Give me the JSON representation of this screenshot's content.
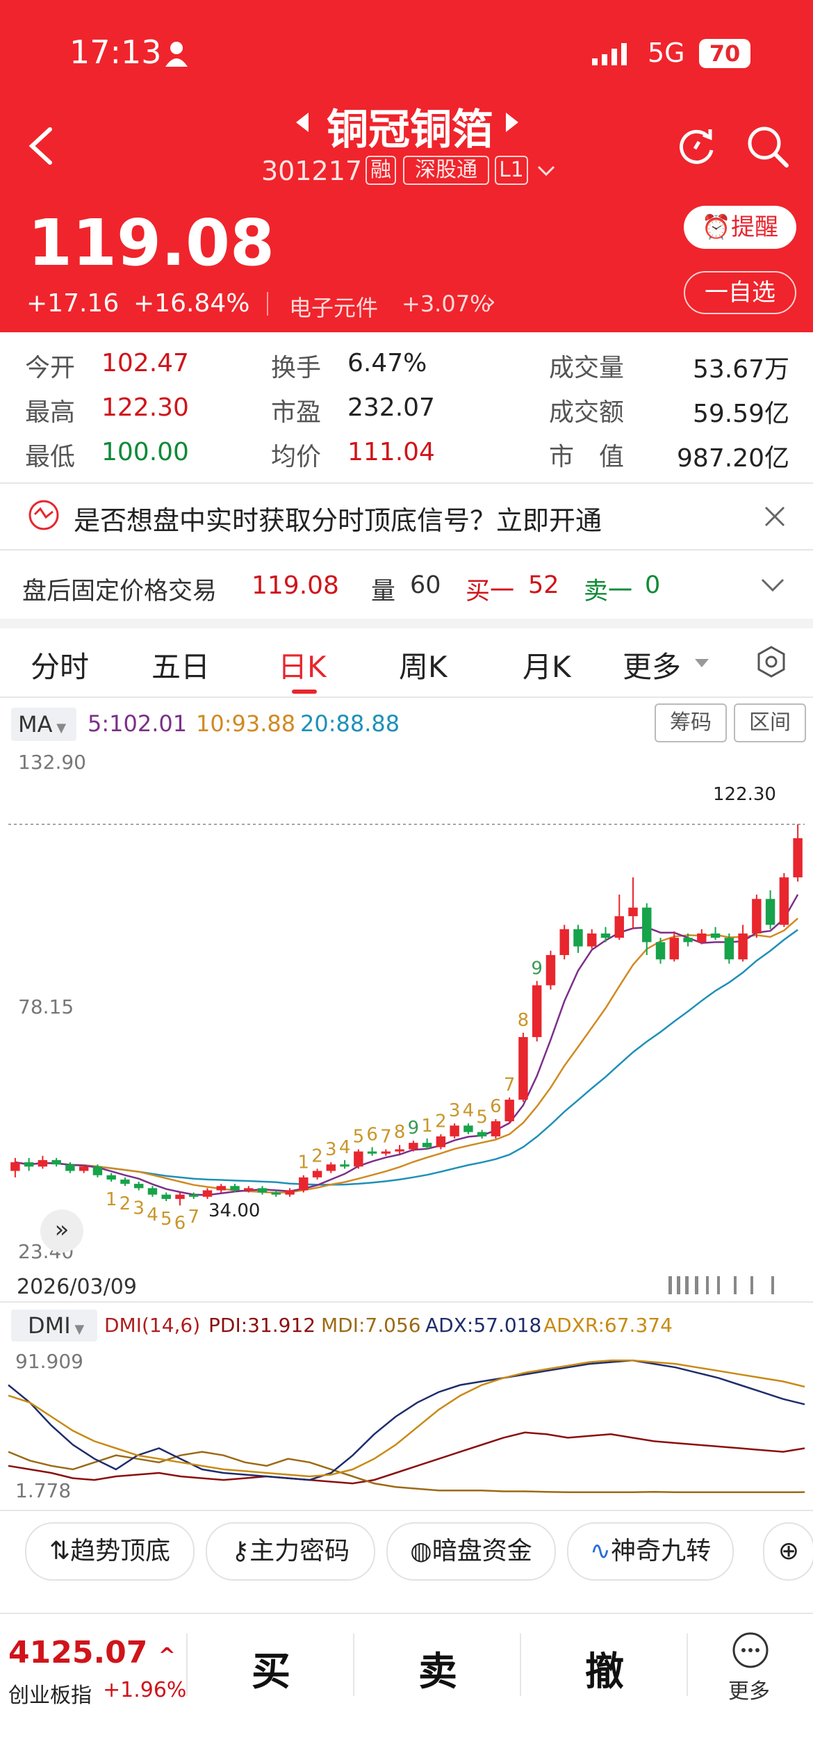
{
  "status_bar": {
    "time": "17:13",
    "network": "5G",
    "battery": "70"
  },
  "stock": {
    "name": "铜冠铜箔",
    "code": "301217",
    "tags": [
      "融",
      "深股通",
      "L1"
    ],
    "price": "119.08",
    "change": "+17.16",
    "change_pct": "+16.84%",
    "sector": "电子元件",
    "sector_change": "+3.07%",
    "remind_label": "提醒",
    "watchlist_label": "一自选"
  },
  "stats": {
    "open_label": "今开",
    "open": "102.47",
    "high_label": "最高",
    "high": "122.30",
    "low_label": "最低",
    "low": "100.00",
    "turnover_label": "换手",
    "turnover": "6.47%",
    "pe_label": "市盈",
    "pe": "232.07",
    "avg_label": "均价",
    "avg": "111.04",
    "volume_label": "成交量",
    "volume": "53.67万",
    "amount_label": "成交额",
    "amount": "59.59亿",
    "mktcap_label": "市　值",
    "mktcap": "987.20亿"
  },
  "signal_banner": "是否想盘中实时获取分时顶底信号？立即开通",
  "after_hours": {
    "label": "盘后固定价格交易",
    "price": "119.08",
    "volume_label": "量",
    "volume": "60",
    "bid_label": "买一",
    "bid": "52",
    "ask_label": "卖一",
    "ask": "0"
  },
  "tabs": [
    "分时",
    "五日",
    "日K",
    "周K",
    "月K",
    "更多"
  ],
  "active_tab": "日K",
  "ma": {
    "label": "MA",
    "ma5": "5:102.01",
    "ma10": "10:93.88",
    "ma20": "20:88.88"
  },
  "chart_buttons": {
    "chips": "筹码",
    "range": "区间"
  },
  "colors": {
    "up": "#e8262e",
    "down": "#16a34a",
    "ma5": "#7c2f8a",
    "ma10": "#d08a22",
    "ma20": "#1e90b8",
    "header": "#f0242c"
  },
  "chart_data": [
    {
      "type": "candlestick",
      "y_ticks": [
        "132.90",
        "78.15",
        "23.40"
      ],
      "ylim": [
        23.4,
        132.9
      ],
      "date_label": "2026/03/09",
      "high_marker": "122.30",
      "low_marker": "34.00",
      "td_numbers_up": [
        "1",
        "2",
        "3",
        "4",
        "5",
        "6",
        "7",
        "8",
        "9",
        "1",
        "2",
        "3",
        "4",
        "5",
        "6",
        "7",
        "8",
        "9"
      ],
      "td_numbers_down": [
        "1",
        "2",
        "3",
        "4",
        "5",
        "6",
        "7"
      ],
      "candles": [
        [
          42,
          44,
          40.5,
          45
        ],
        [
          44,
          43,
          42,
          45
        ],
        [
          43,
          44.5,
          42.5,
          45.5
        ],
        [
          44.5,
          43.5,
          43,
          45
        ],
        [
          43.5,
          42,
          41.5,
          44
        ],
        [
          42,
          43,
          41.5,
          43.5
        ],
        [
          43,
          41,
          40.5,
          43.5
        ],
        [
          41,
          40,
          39.5,
          41.5
        ],
        [
          40,
          39,
          38.5,
          40.5
        ],
        [
          39,
          38,
          37.5,
          39.5
        ],
        [
          38,
          36.5,
          36,
          38.5
        ],
        [
          36.5,
          35.5,
          35,
          37
        ],
        [
          35.5,
          36.5,
          34,
          37
        ],
        [
          36.5,
          36,
          35.5,
          37
        ],
        [
          36,
          37.5,
          35.5,
          38
        ],
        [
          37.5,
          38.5,
          37,
          39
        ],
        [
          38.5,
          37.5,
          37,
          39
        ],
        [
          37.5,
          38,
          37,
          38.5
        ],
        [
          38,
          37,
          36.5,
          38.5
        ],
        [
          37,
          36.5,
          36,
          37.5
        ],
        [
          36.5,
          37.5,
          36,
          38
        ],
        [
          37.5,
          40.5,
          37,
          41
        ],
        [
          40.5,
          42,
          40,
          42.5
        ],
        [
          42,
          43.5,
          41.5,
          44
        ],
        [
          43.5,
          43,
          42.5,
          44.5
        ],
        [
          43,
          46.5,
          42.5,
          47
        ],
        [
          46.5,
          46,
          45.5,
          47.5
        ],
        [
          46,
          46.5,
          45.5,
          47
        ],
        [
          46.5,
          47,
          46,
          48
        ],
        [
          47,
          48.5,
          46.5,
          49
        ],
        [
          48.5,
          47.5,
          47,
          49.5
        ],
        [
          47.5,
          50,
          47,
          50.5
        ],
        [
          50,
          52.5,
          49.5,
          53
        ],
        [
          52.5,
          51,
          50.5,
          53
        ],
        [
          51,
          50,
          49.5,
          51.5
        ],
        [
          50,
          53.5,
          49.5,
          54
        ],
        [
          53.5,
          58.5,
          53,
          59
        ],
        [
          58.5,
          73,
          58,
          74
        ],
        [
          73,
          85,
          72,
          86
        ],
        [
          85,
          92,
          84,
          93
        ],
        [
          92,
          98,
          91,
          99
        ],
        [
          98,
          94,
          92.5,
          99
        ],
        [
          94,
          97,
          93.5,
          98
        ],
        [
          97,
          96,
          95,
          98.5
        ],
        [
          96,
          101,
          95.5,
          106
        ],
        [
          101,
          103,
          98,
          110
        ],
        [
          103,
          95,
          92,
          104
        ],
        [
          95,
          91,
          90,
          96
        ],
        [
          91,
          96,
          90.5,
          97.5
        ],
        [
          96,
          95,
          94,
          97
        ],
        [
          95,
          97,
          94.5,
          98
        ],
        [
          97,
          96,
          95.5,
          98.5
        ],
        [
          96,
          91,
          90,
          97
        ],
        [
          91,
          97,
          90.5,
          99
        ],
        [
          97,
          105,
          96,
          106
        ],
        [
          105,
          99,
          98,
          107
        ],
        [
          99,
          110,
          98.5,
          111
        ],
        [
          110,
          119.08,
          109,
          122.3
        ]
      ]
    },
    {
      "type": "line",
      "label": "DMI",
      "params": "DMI(14,6)",
      "series": [
        {
          "name": "PDI:31.912",
          "color": "#8b0e0e",
          "values": [
            22,
            20,
            18,
            15,
            14,
            16,
            17,
            18,
            16,
            15,
            14,
            15,
            16,
            15,
            14,
            13,
            12,
            14,
            18,
            22,
            26,
            30,
            34,
            38,
            41,
            40,
            38,
            39,
            40,
            38,
            36,
            35,
            34,
            33,
            32,
            31,
            30,
            32
          ]
        },
        {
          "name": "MDI:7.056",
          "color": "#9c6a14",
          "values": [
            30,
            25,
            22,
            20,
            24,
            28,
            26,
            24,
            28,
            30,
            28,
            24,
            22,
            26,
            24,
            20,
            16,
            12,
            10,
            9,
            8,
            8,
            8,
            7.5,
            7.5,
            7.2,
            7,
            7,
            7,
            7,
            7.2,
            7,
            7,
            7,
            7,
            7,
            7,
            7.056
          ]
        },
        {
          "name": "ADX:57.018",
          "color": "#1f2d6b",
          "values": [
            68,
            58,
            45,
            34,
            26,
            20,
            28,
            32,
            26,
            20,
            18,
            17,
            16,
            15,
            14,
            18,
            28,
            40,
            50,
            58,
            64,
            68,
            70,
            72,
            74,
            76,
            78,
            80,
            81,
            82,
            80,
            78,
            75,
            72,
            68,
            64,
            60,
            57
          ]
        },
        {
          "name": "ADXR:67.374",
          "color": "#c88a14",
          "values": [
            62,
            58,
            50,
            42,
            36,
            32,
            28,
            26,
            24,
            22,
            20,
            19,
            18,
            17,
            16,
            17,
            20,
            26,
            34,
            44,
            54,
            62,
            68,
            72,
            75,
            77,
            79,
            81,
            82,
            82,
            81,
            80,
            78,
            76,
            74,
            72,
            70,
            67
          ]
        }
      ],
      "y_ticks": [
        "91.909",
        "1.778"
      ],
      "ylim": [
        1.778,
        91.909
      ]
    }
  ],
  "toolbar": [
    "趋势顶底",
    "主力密码",
    "暗盘资金",
    "神奇九转"
  ],
  "index": {
    "value": "4125.07",
    "name": "创业板指",
    "change": "+1.96%"
  },
  "actions": {
    "buy": "买",
    "sell": "卖",
    "cancel": "撤",
    "more": "更多"
  }
}
